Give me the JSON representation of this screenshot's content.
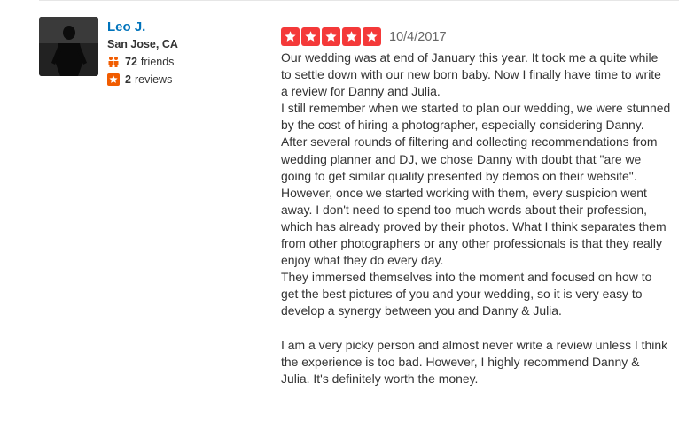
{
  "user": {
    "name": "Leo J.",
    "location": "San Jose, CA",
    "friends_count": "72",
    "friends_label": "friends",
    "reviews_count": "2",
    "reviews_label": "reviews"
  },
  "review": {
    "rating": 5,
    "date": "10/4/2017",
    "paragraphs": [
      "Our wedding was at end of January this year. It took me a quite while to settle down with our new born baby. Now I finally have time to write a review for Danny and Julia.",
      "I still remember when we started to plan our wedding, we were stunned by the cost of hiring a photographer, especially considering Danny. After several rounds of filtering and collecting recommendations from wedding planner and DJ, we chose Danny with doubt that \"are we going to get similar quality presented by demos on their website\". However, once we started working with them, every suspicion went away. I don't need to spend too much words about their profession, which has already proved by their photos. What I think separates them from other photographers or any other professionals is that they really enjoy what they do every day.",
      "They immersed themselves into the moment and focused on how to get the best pictures of you and your wedding, so it is very easy to develop a synergy between you and Danny & Julia.",
      "I am a very picky person and almost never write a review unless I think the experience is too bad. However, I highly recommend Danny & Julia. It's definitely worth the money."
    ]
  },
  "icons": {
    "friends": "friends-icon",
    "reviews": "review-star-icon",
    "rating_star": "star-icon"
  },
  "colors": {
    "name_link": "#0073bb",
    "star_red": "#f43939",
    "friends_icon": "#f15c00",
    "reviews_icon": "#f15c00"
  }
}
